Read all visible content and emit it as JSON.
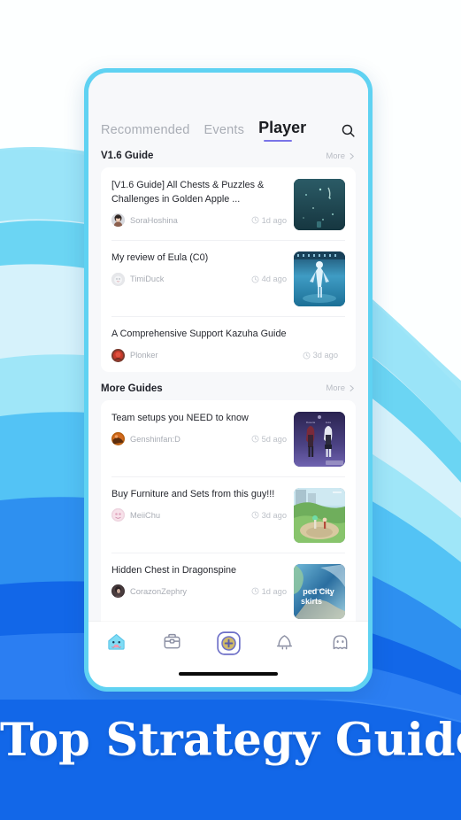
{
  "banner": {
    "title": "Top Strategy Guides",
    "background_color": "#1267e8"
  },
  "phone": {
    "frame_color": "#5fd2f2",
    "screen_bg": "#f7f8fa"
  },
  "tabs": [
    {
      "label": "Recommended",
      "active": false
    },
    {
      "label": "Events",
      "active": false
    },
    {
      "label": "Player",
      "active": true
    }
  ],
  "tab_accent_color": "#7a74e8",
  "search": {
    "icon": "search-icon"
  },
  "sections": [
    {
      "title": "V1.6 Guide",
      "more_label": "More",
      "more_icon": "chevron-right-icon",
      "items": [
        {
          "title": "[V1.6 Guide] All Chests & Puzzles & Challenges in Golden Apple ...",
          "author": "SoraHoshina",
          "time": "1d ago",
          "time_icon": "clock-icon",
          "thumb": "thumb-dark-ocean",
          "has_thumb": true
        },
        {
          "title": "My review of Eula (C0)",
          "author": "TimiDuck",
          "time": "4d ago",
          "time_icon": "clock-icon",
          "thumb": "thumb-eula-blue",
          "has_thumb": true
        },
        {
          "title": "A Comprehensive Support Kazuha Guide",
          "author": "Plonker",
          "time": "3d ago",
          "time_icon": "clock-icon",
          "thumb": "",
          "has_thumb": false
        }
      ]
    },
    {
      "title": "More Guides",
      "more_label": "More",
      "more_icon": "chevron-right-icon",
      "items": [
        {
          "title": "Team setups you NEED to know",
          "author": "Genshinfan:D",
          "time": "5d ago",
          "time_icon": "clock-icon",
          "thumb": "thumb-team-purple",
          "has_thumb": true
        },
        {
          "title": "Buy Furniture and Sets from this guy!!!",
          "author": "MeiiChu",
          "time": "3d ago",
          "time_icon": "clock-icon",
          "thumb": "thumb-furniture-green",
          "has_thumb": true
        },
        {
          "title": "Hidden Chest in Dragonspine",
          "author": "CorazonZephry",
          "time": "1d ago",
          "time_icon": "clock-icon",
          "thumb": "thumb-map-city",
          "thumb_text": "ped City skirts",
          "has_thumb": true
        }
      ]
    }
  ],
  "bottom_nav": [
    {
      "name": "home",
      "icon": "slime-home-icon",
      "active": true
    },
    {
      "name": "toolbox",
      "icon": "toolbox-icon",
      "active": false
    },
    {
      "name": "create",
      "icon": "add-circle-icon",
      "active": false
    },
    {
      "name": "notifications",
      "icon": "bell-icon",
      "active": false
    },
    {
      "name": "profile",
      "icon": "ghost-profile-icon",
      "active": false
    }
  ]
}
